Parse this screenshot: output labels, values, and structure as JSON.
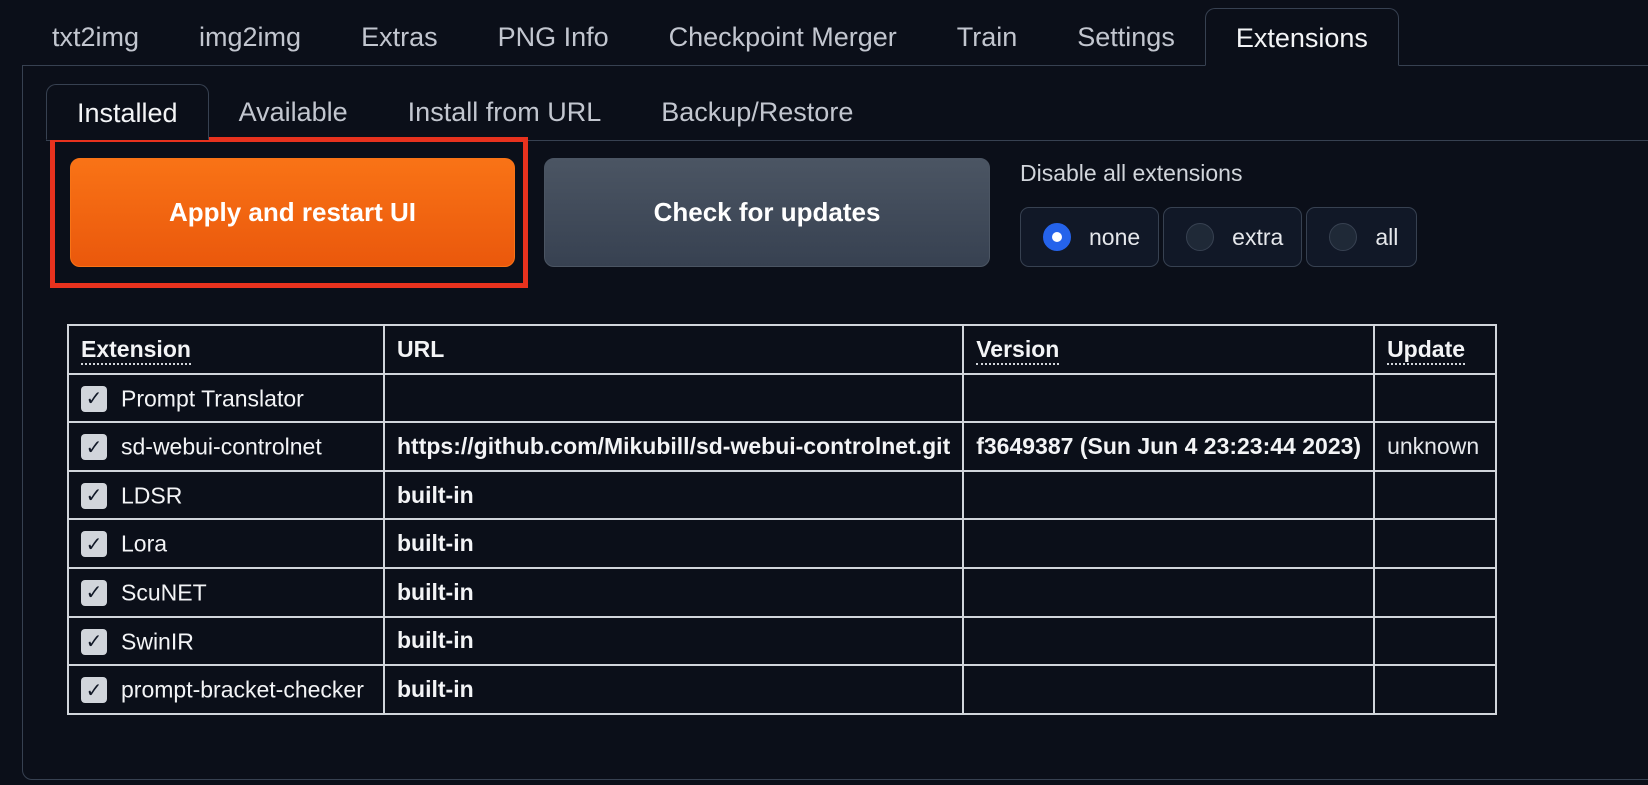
{
  "top_tabs": [
    "txt2img",
    "img2img",
    "Extras",
    "PNG Info",
    "Checkpoint Merger",
    "Train",
    "Settings",
    "Extensions"
  ],
  "active_top_tab": "Extensions",
  "sub_tabs": [
    "Installed",
    "Available",
    "Install from URL",
    "Backup/Restore"
  ],
  "active_sub_tab": "Installed",
  "buttons": {
    "apply_label": "Apply and restart UI",
    "check_label": "Check for updates"
  },
  "disable_extensions": {
    "label": "Disable all extensions",
    "options": [
      "none",
      "extra",
      "all"
    ],
    "selected": "none"
  },
  "table": {
    "headers": {
      "extension": "Extension",
      "url": "URL",
      "version": "Version",
      "update": "Update"
    },
    "rows": [
      {
        "name": "Prompt Translator",
        "checked": true,
        "url": "",
        "version": "",
        "update": ""
      },
      {
        "name": "sd-webui-controlnet",
        "checked": true,
        "url": "https://github.com/Mikubill/sd-webui-controlnet.git",
        "version": "f3649387 (Sun Jun 4 23:23:44 2023)",
        "update": "unknown"
      },
      {
        "name": "LDSR",
        "checked": true,
        "url": "built-in",
        "version": "",
        "update": ""
      },
      {
        "name": "Lora",
        "checked": true,
        "url": "built-in",
        "version": "",
        "update": ""
      },
      {
        "name": "ScuNET",
        "checked": true,
        "url": "built-in",
        "version": "",
        "update": ""
      },
      {
        "name": "SwinIR",
        "checked": true,
        "url": "built-in",
        "version": "",
        "update": ""
      },
      {
        "name": "prompt-bracket-checker",
        "checked": true,
        "url": "built-in",
        "version": "",
        "update": ""
      }
    ]
  },
  "colors": {
    "background": "#0b0f19",
    "accent_orange": "#f97316",
    "highlight_red": "#e8321e",
    "radio_blue": "#2563eb"
  }
}
